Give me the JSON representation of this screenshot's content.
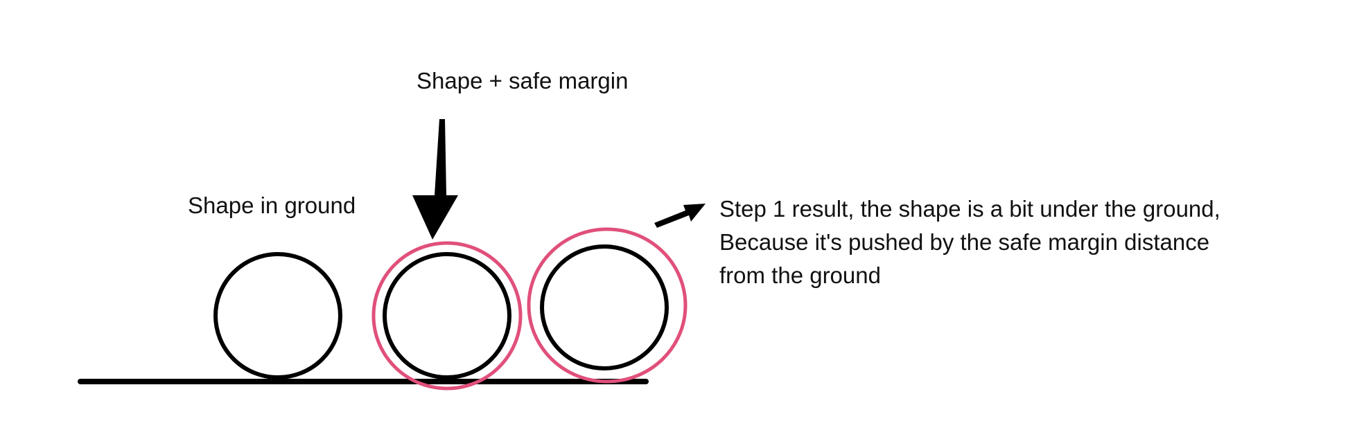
{
  "labels": {
    "shape_in_ground": "Shape in ground",
    "shape_plus_margin": "Shape + safe margin",
    "result_line_1": "Step 1 result, the shape is a bit under the ground,",
    "result_line_2": "Because it's pushed by the safe margin distance",
    "result_line_3": "from the ground"
  },
  "colors": {
    "shape_stroke": "#000000",
    "margin_stroke": "#e0507a",
    "text": "#111111"
  },
  "icons": {
    "down_arrow": "arrow-down-icon",
    "right_arrow": "arrow-right-icon"
  }
}
